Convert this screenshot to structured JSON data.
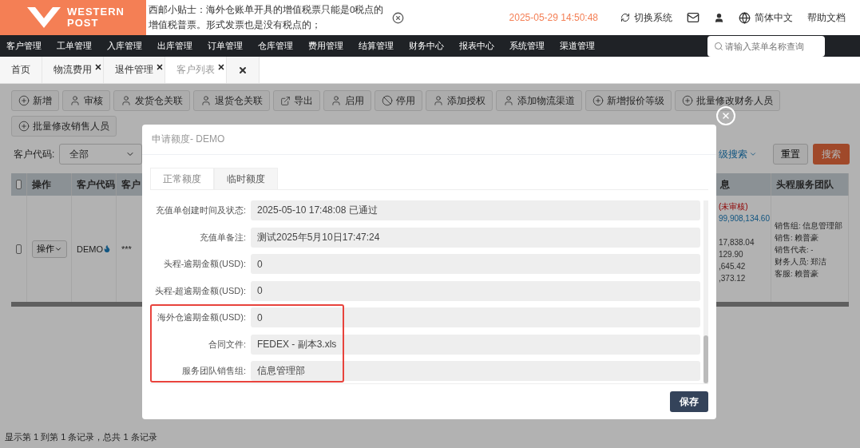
{
  "header": {
    "logo": [
      "WESTERN",
      "POST"
    ],
    "notice": "西邮小贴士：海外仓账单开具的增值税票只能是0税点的增值税普票。形式发票也是没有税点的；",
    "date": "2025-05-29 14:50:48",
    "actions": [
      {
        "kind": "switch",
        "label": "切换系统"
      },
      {
        "kind": "mail"
      },
      {
        "kind": "user"
      },
      {
        "kind": "language",
        "label": "简体中文"
      },
      {
        "kind": "help",
        "label": "帮助文档"
      }
    ]
  },
  "nav": {
    "items": [
      "客户管理",
      "工单管理",
      "入库管理",
      "出库管理",
      "订单管理",
      "仓库管理",
      "费用管理",
      "结算管理",
      "财务中心",
      "报表中心",
      "系统管理",
      "渠道管理"
    ],
    "search": {
      "placeholder": "请输入菜单名称查询"
    }
  },
  "tabs": [
    {
      "kind": "page",
      "label": "首页",
      "closable": false,
      "selected": false
    },
    {
      "kind": "page",
      "label": "物流费用",
      "closable": true,
      "selected": false
    },
    {
      "kind": "page",
      "label": "退件管理",
      "closable": true,
      "selected": false
    },
    {
      "kind": "page",
      "label": "客户列表",
      "closable": true,
      "selected": true
    },
    {
      "kind": "close-all",
      "selected": false
    }
  ],
  "toolbar": [
    [
      {
        "kind": "plus",
        "label": "新增"
      },
      {
        "kind": "user",
        "label": "审核"
      },
      {
        "kind": "user",
        "label": "发货仓关联"
      },
      {
        "kind": "user",
        "label": "退货仓关联"
      },
      {
        "kind": "export",
        "label": "导出"
      },
      {
        "kind": "user",
        "label": "启用"
      },
      {
        "kind": "ban",
        "label": "停用"
      },
      {
        "kind": "user",
        "label": "添加授权"
      },
      {
        "kind": "user",
        "label": "添加物流渠道"
      },
      {
        "kind": "plus",
        "label": "新增报价等级"
      },
      {
        "kind": "plus",
        "label": "批量修改财务人员"
      }
    ],
    [
      {
        "kind": "plus",
        "label": "批量修改销售人员"
      }
    ]
  ],
  "filter": {
    "label": "客户代码:",
    "select": "全部",
    "advanced": "级搜索",
    "reset": "重置",
    "search": "搜索"
  },
  "table": {
    "columns": [
      "操作",
      "客户代码",
      "客户",
      "息",
      "头程服务团队"
    ],
    "all_checked": false,
    "rows": [
      {
        "checked": false,
        "action": "操作",
        "code": "DEMO",
        "hot": true,
        "name": "***",
        "info": [
          {
            "kind": "warning",
            "text": "(未审核)"
          },
          {
            "kind": "link",
            "text": "99,908,134.60"
          },
          {
            "kind": "gap"
          },
          {
            "kind": "plain",
            "text": "17,838.04"
          },
          {
            "kind": "plain",
            "text": "129.90"
          },
          {
            "kind": "plain",
            "text": ",645.42"
          },
          {
            "kind": "plain",
            "text": ",373.12"
          }
        ],
        "team": [
          "销售组: 信息管理部",
          "销售: 赖普豪",
          "销售代表: -",
          "财务人员: 郑洁",
          "客服: 赖普豪"
        ]
      }
    ]
  },
  "footer": "显示第 1 到第 1 条记录，总共 1 条记录",
  "modal": {
    "title": "申请额度- DEMO",
    "tabs": [
      {
        "label": "正常额度",
        "selected": true
      },
      {
        "label": "临时额度",
        "selected": false
      }
    ],
    "rows": [
      {
        "label": "充值单创建时间及状态:",
        "value": "2025-05-10 17:48:08 已通过",
        "highlighted": false
      },
      {
        "label": "充值单备注:",
        "value": "测试2025年5月10日17:47:24",
        "highlighted": false
      },
      {
        "label": "头程-逾期金额(USD):",
        "value": "0",
        "highlighted": false
      },
      {
        "label": "头程-超逾期金额(USD):",
        "value": "0",
        "highlighted": false
      },
      {
        "label": "海外仓逾期金额(USD):",
        "value": "0",
        "highlighted": true
      },
      {
        "label": "合同文件:",
        "value": "FEDEX - 副本3.xls",
        "highlighted": true
      },
      {
        "label": "服务团队销售组:",
        "value": "信息管理部",
        "highlighted": true
      }
    ],
    "save": "保存"
  }
}
